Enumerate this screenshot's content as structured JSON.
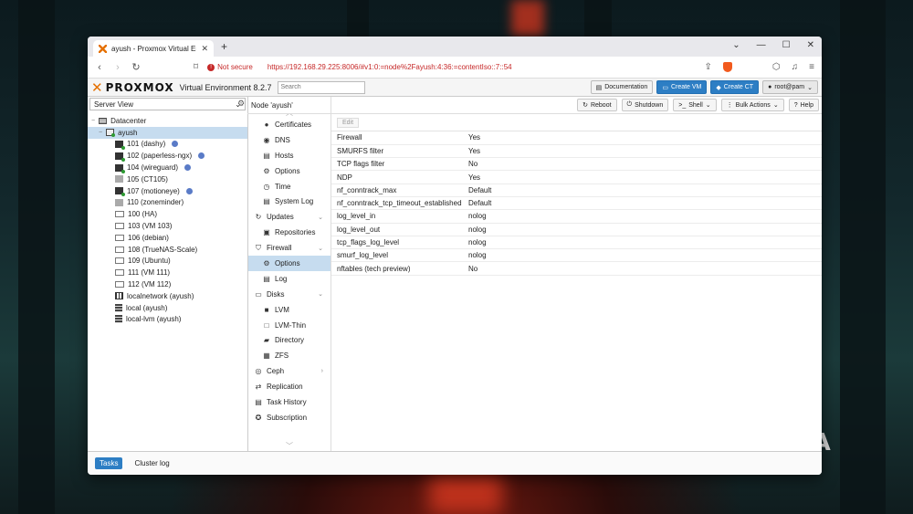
{
  "browser": {
    "tab_title": "ayush - Proxmox Virtual Environ",
    "url": "https://192.168.29.225:8006/#v1:0:=node%2Fayush:4:36:=contentIso::7::54",
    "security_label": "Not secure"
  },
  "pve": {
    "brand": "PROXMOX",
    "version": "Virtual Environment 8.2.7",
    "search_placeholder": "Search",
    "header_buttons": {
      "documentation": "Documentation",
      "create_vm": "Create VM",
      "create_ct": "Create CT",
      "user": "root@pam"
    },
    "server_view": "Server View"
  },
  "tree": {
    "datacenter": "Datacenter",
    "node": "ayush",
    "guests": [
      {
        "label": "101 (dashy)",
        "kind": "ct-running",
        "tag": true
      },
      {
        "label": "102 (paperless-ngx)",
        "kind": "ct-running",
        "tag": true
      },
      {
        "label": "104 (wireguard)",
        "kind": "ct-running",
        "tag": true
      },
      {
        "label": "105 (CT105)",
        "kind": "ct-stopped",
        "tag": false
      },
      {
        "label": "107 (motioneye)",
        "kind": "ct-running",
        "tag": true
      },
      {
        "label": "110 (zoneminder)",
        "kind": "ct-stopped",
        "tag": false
      },
      {
        "label": "100 (HA)",
        "kind": "vm",
        "tag": false
      },
      {
        "label": "103 (VM 103)",
        "kind": "vm",
        "tag": false
      },
      {
        "label": "106 (debian)",
        "kind": "vm",
        "tag": false
      },
      {
        "label": "108 (TrueNAS-Scale)",
        "kind": "vm",
        "tag": false
      },
      {
        "label": "109 (Ubuntu)",
        "kind": "vm",
        "tag": false
      },
      {
        "label": "111 (VM 111)",
        "kind": "vm",
        "tag": false
      },
      {
        "label": "112 (VM 112)",
        "kind": "vm",
        "tag": false
      }
    ],
    "network": "localnetwork (ayush)",
    "storage": [
      "local (ayush)",
      "local-lvm (ayush)"
    ]
  },
  "menu": [
    {
      "label": "Certificates",
      "icon": "●",
      "sub": true
    },
    {
      "label": "DNS",
      "icon": "◉",
      "sub": true
    },
    {
      "label": "Hosts",
      "icon": "▤",
      "sub": true
    },
    {
      "label": "Options",
      "icon": "⚙",
      "sub": true
    },
    {
      "label": "Time",
      "icon": "◷",
      "sub": true
    },
    {
      "label": "System Log",
      "icon": "▤",
      "sub": true
    },
    {
      "label": "Updates",
      "icon": "↻",
      "sub": false,
      "expand": "⌄"
    },
    {
      "label": "Repositories",
      "icon": "▣",
      "sub": true
    },
    {
      "label": "Firewall",
      "icon": "⛉",
      "sub": false,
      "expand": "⌄"
    },
    {
      "label": "Options",
      "icon": "⚙",
      "sub": true,
      "active": true
    },
    {
      "label": "Log",
      "icon": "▤",
      "sub": true
    },
    {
      "label": "Disks",
      "icon": "▭",
      "sub": false,
      "expand": "⌄"
    },
    {
      "label": "LVM",
      "icon": "■",
      "sub": true
    },
    {
      "label": "LVM-Thin",
      "icon": "□",
      "sub": true
    },
    {
      "label": "Directory",
      "icon": "▰",
      "sub": true
    },
    {
      "label": "ZFS",
      "icon": "▦",
      "sub": true
    },
    {
      "label": "Ceph",
      "icon": "◎",
      "sub": false,
      "expand": "›"
    },
    {
      "label": "Replication",
      "icon": "⇄",
      "sub": false
    },
    {
      "label": "Task History",
      "icon": "▤",
      "sub": false
    },
    {
      "label": "Subscription",
      "icon": "✪",
      "sub": false
    }
  ],
  "content": {
    "title": "Node 'ayush'",
    "tools": {
      "reboot": "Reboot",
      "shutdown": "Shutdown",
      "shell": "Shell",
      "bulk": "Bulk Actions",
      "help": "Help"
    },
    "edit": "Edit",
    "options": [
      {
        "key": "Firewall",
        "value": "Yes"
      },
      {
        "key": "SMURFS filter",
        "value": "Yes"
      },
      {
        "key": "TCP flags filter",
        "value": "No"
      },
      {
        "key": "NDP",
        "value": "Yes"
      },
      {
        "key": "nf_conntrack_max",
        "value": "Default"
      },
      {
        "key": "nf_conntrack_tcp_timeout_established",
        "value": "Default"
      },
      {
        "key": "log_level_in",
        "value": "nolog"
      },
      {
        "key": "log_level_out",
        "value": "nolog"
      },
      {
        "key": "tcp_flags_log_level",
        "value": "nolog"
      },
      {
        "key": "smurf_log_level",
        "value": "nolog"
      },
      {
        "key": "nftables (tech preview)",
        "value": "No"
      }
    ]
  },
  "footer": {
    "tasks": "Tasks",
    "cluster_log": "Cluster log"
  },
  "watermark": "XDA",
  "colors": {
    "accent": "#2d7ec4",
    "selection": "#c6dcef",
    "proxmox_orange": "#e57000",
    "insecure": "#c62828"
  }
}
